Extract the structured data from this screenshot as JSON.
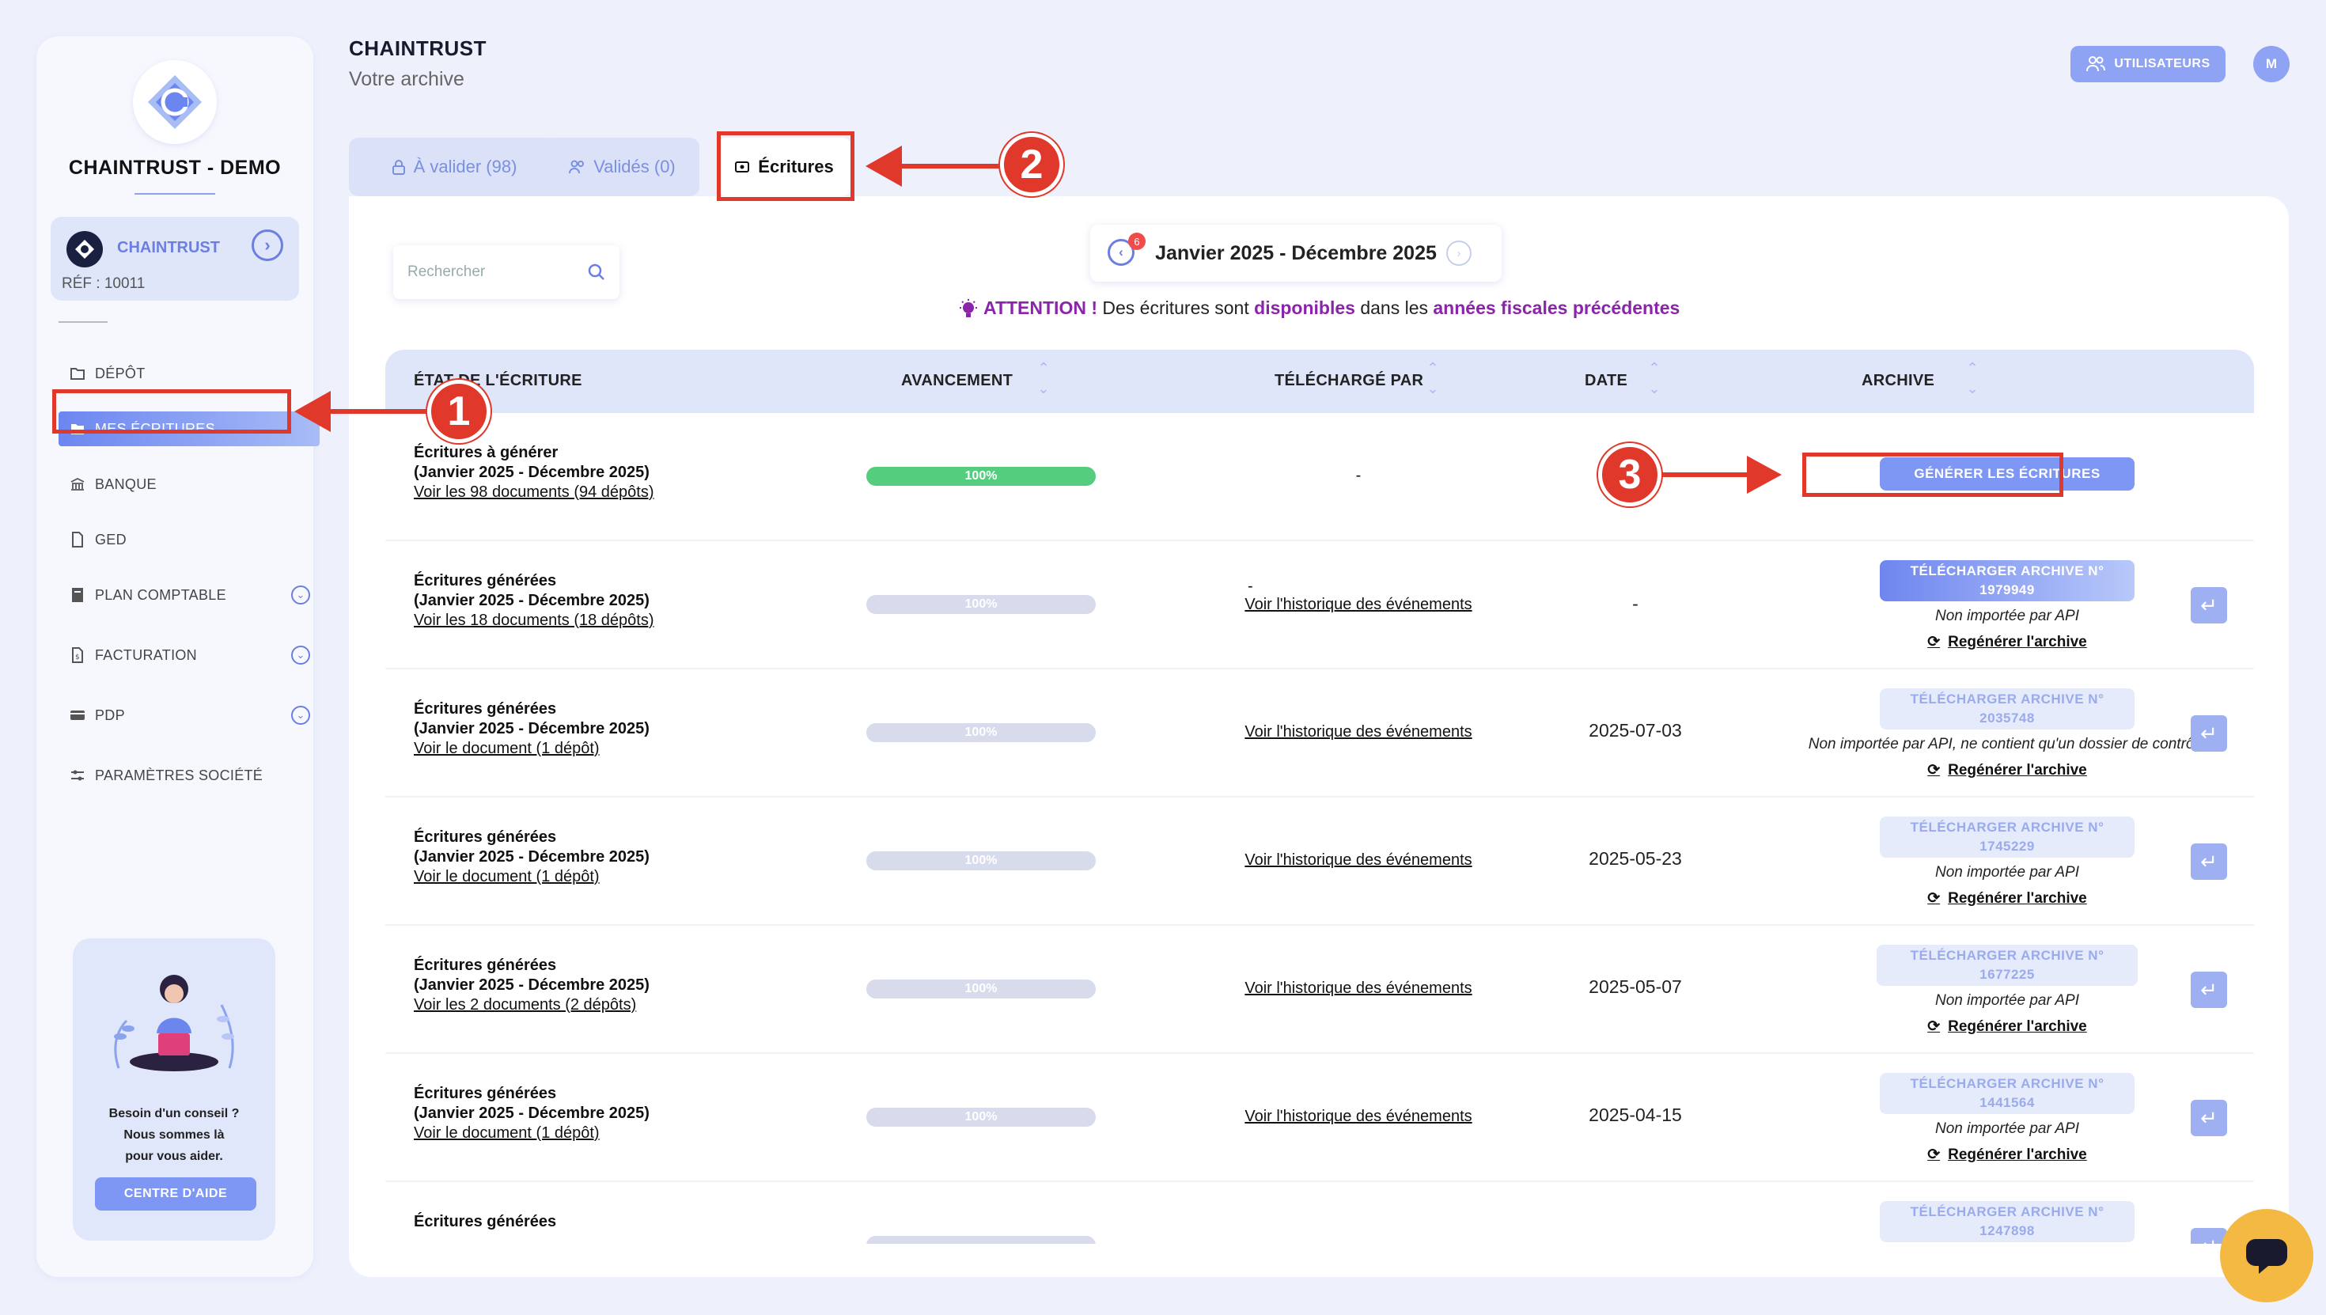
{
  "sidebar": {
    "company_name": "CHAINTRUST - DEMO",
    "account": {
      "name": "CHAINTRUST",
      "ref": "RÉF : 10011"
    },
    "nav": [
      {
        "label": "DÉPÔT",
        "icon": "folder-icon"
      },
      {
        "label": "MES ÉCRITURES",
        "icon": "folder-pen-icon",
        "active": true
      },
      {
        "label": "BANQUE",
        "icon": "bank-icon"
      },
      {
        "label": "GED",
        "icon": "document-icon"
      },
      {
        "label": "PLAN COMPTABLE",
        "icon": "book-icon",
        "expandable": true
      },
      {
        "label": "FACTURATION",
        "icon": "invoice-icon",
        "expandable": true
      },
      {
        "label": "PDP",
        "icon": "card-icon",
        "expandable": true
      },
      {
        "label": "PARAMÈTRES SOCIÉTÉ",
        "icon": "sliders-icon"
      }
    ],
    "help": {
      "line1": "Besoin d'un conseil ?",
      "line2": "Nous sommes là",
      "line3": "pour vous aider.",
      "button": "CENTRE D'AIDE"
    }
  },
  "header": {
    "title": "CHAINTRUST",
    "subtitle": "Votre archive",
    "users_button": "UTILISATEURS",
    "avatar_initial": "M"
  },
  "tabs": [
    {
      "label": "À valider (98)"
    },
    {
      "label": "Validés (0)"
    },
    {
      "label": "Écritures",
      "active": true
    }
  ],
  "search": {
    "placeholder": "Rechercher"
  },
  "period": {
    "label": "Janvier 2025 - Décembre 2025",
    "badge": "6"
  },
  "attention": {
    "p1": "ATTENTION !",
    "p2": " Des écritures sont ",
    "p3": "disponibles",
    "p4": " dans les ",
    "p5": "années fiscales précédentes"
  },
  "table": {
    "headers": {
      "state": "ÉTAT DE L'ÉCRITURE",
      "progress": "AVANCEMENT",
      "by": "TÉLÉCHARGÉ PAR",
      "date": "DATE",
      "archive": "ARCHIVE"
    },
    "rows": [
      {
        "title": "Écritures à générer",
        "period": "(Janvier 2025 - Décembre 2025)",
        "link": "Voir les 98 documents (94 dépôts)",
        "progress": "100%",
        "progress_value": 1.0,
        "by_dash": "-",
        "by_link": "",
        "date": "",
        "archive_button": "GÉNÉRER LES ÉCRITURES",
        "archive_note": "",
        "regen": ""
      },
      {
        "title": "Écritures générées",
        "period": "(Janvier 2025 - Décembre 2025)",
        "link": "Voir les 18 documents (18 dépôts)",
        "progress": "100%",
        "progress_value": 1.0,
        "by_dash": "-",
        "by_link": "Voir l'historique des événements",
        "date": "-",
        "archive_button": "TÉLÉCHARGER ARCHIVE N° 1979949",
        "archive_note": "Non importée par API",
        "regen": "Regénérer l'archive"
      },
      {
        "title": "Écritures générées",
        "period": "(Janvier 2025 - Décembre 2025)",
        "link": "Voir le document (1 dépôt)",
        "progress": "100%",
        "progress_value": 1.0,
        "by_dash": "",
        "by_link": "Voir l'historique des événements",
        "date": "2025-07-03",
        "archive_button": "TÉLÉCHARGER ARCHIVE N° 2035748",
        "archive_note": "Non importée par API, ne contient qu'un dossier de contrôle",
        "regen": "Regénérer l'archive"
      },
      {
        "title": "Écritures générées",
        "period": "(Janvier 2025 - Décembre 2025)",
        "link": "Voir le document (1 dépôt)",
        "progress": "100%",
        "progress_value": 1.0,
        "by_dash": "",
        "by_link": "Voir l'historique des événements",
        "date": "2025-05-23",
        "archive_button": "TÉLÉCHARGER ARCHIVE N° 1745229",
        "archive_note": "Non importée par API",
        "regen": "Regénérer l'archive"
      },
      {
        "title": "Écritures générées",
        "period": "(Janvier 2025 - Décembre 2025)",
        "link": "Voir les 2 documents (2 dépôts)",
        "progress": "100%",
        "progress_value": 1.0,
        "by_dash": "",
        "by_link": "Voir l'historique des événements",
        "date": "2025-05-07",
        "archive_button": "TÉLÉCHARGER ARCHIVE N° 1677225",
        "archive_note": "Non importée par API",
        "regen": "Regénérer l'archive"
      },
      {
        "title": "Écritures générées",
        "period": "(Janvier 2025 - Décembre 2025)",
        "link": "Voir le document (1 dépôt)",
        "progress": "100%",
        "progress_value": 1.0,
        "by_dash": "",
        "by_link": "Voir l'historique des événements",
        "date": "2025-04-15",
        "archive_button": "TÉLÉCHARGER ARCHIVE N° 1441564",
        "archive_note": "Non importée par API",
        "regen": "Regénérer l'archive"
      },
      {
        "title": "Écritures générées",
        "period": "",
        "link": "",
        "progress": "",
        "progress_value": 1.0,
        "by_dash": "",
        "by_link": "",
        "date": "",
        "archive_button": "TÉLÉCHARGER ARCHIVE N° 1247898",
        "archive_note": "",
        "regen": ""
      }
    ]
  },
  "annotations": {
    "one": "1",
    "two": "2",
    "three": "3"
  },
  "colors": {
    "accent": "#6c7fe0",
    "highlight": "#e0382a",
    "success": "#54cd7f",
    "attention": "#8a24a8",
    "chat": "#f4b942"
  }
}
